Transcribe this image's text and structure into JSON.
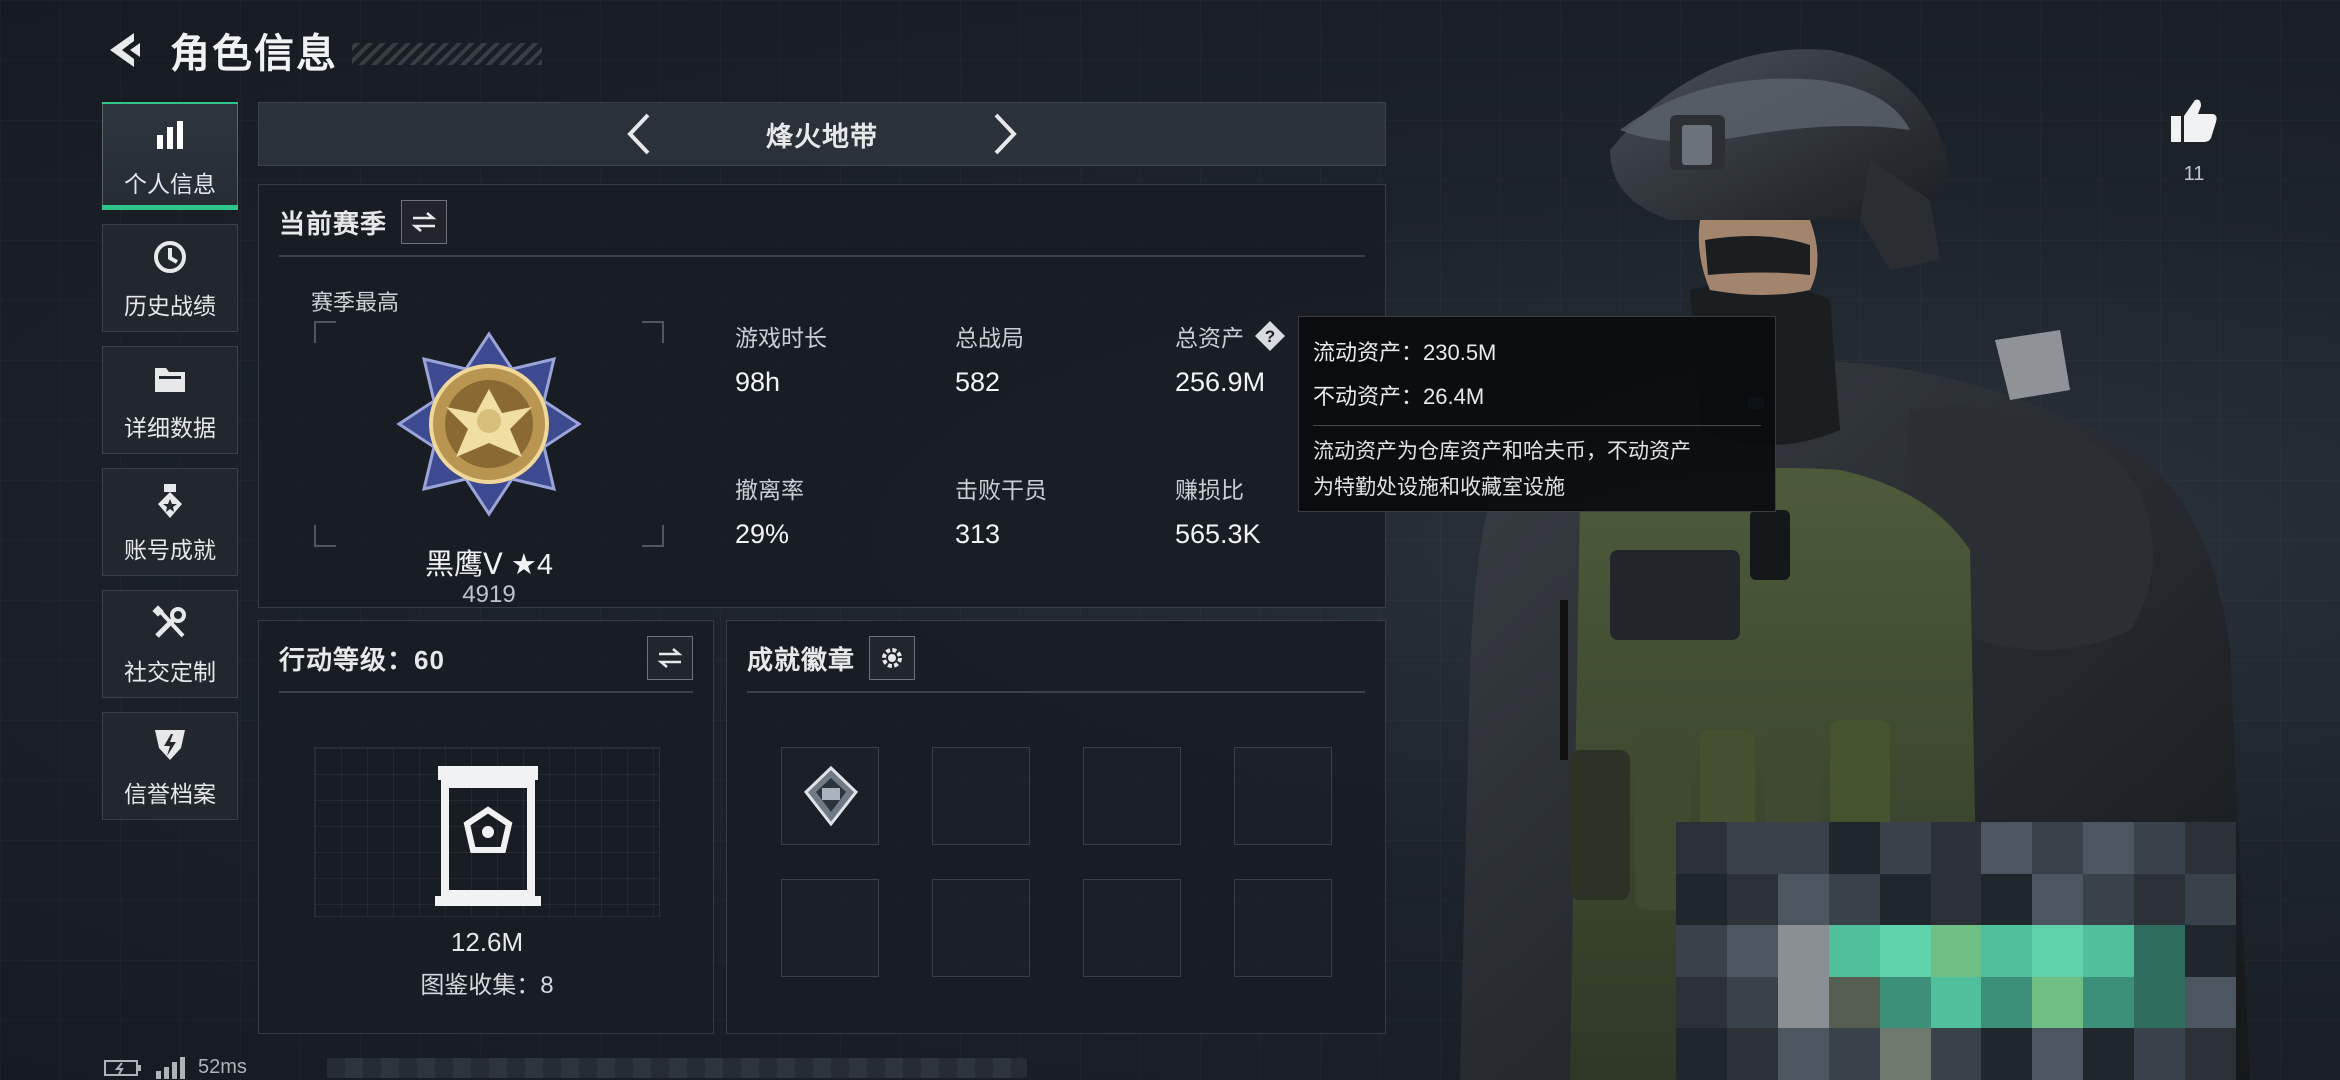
{
  "header": {
    "title": "角色信息"
  },
  "sidenav": {
    "items": [
      {
        "label": "个人信息",
        "icon": "bar-chart-icon",
        "active": true
      },
      {
        "label": "历史战绩",
        "icon": "history-clock-icon",
        "active": false
      },
      {
        "label": "详细数据",
        "icon": "folder-icon",
        "active": false
      },
      {
        "label": "账号成就",
        "icon": "medal-icon",
        "active": false
      },
      {
        "label": "社交定制",
        "icon": "tools-icon",
        "active": false
      },
      {
        "label": "信誉档案",
        "icon": "shield-badge-icon",
        "active": false
      }
    ]
  },
  "mode": {
    "title": "烽火地带"
  },
  "season": {
    "title": "当前赛季",
    "subtitle": "赛季最高",
    "rank_name": "黑鹰Ⅴ ★4",
    "rank_score": "4919",
    "stats": [
      {
        "label": "游戏时长",
        "value": "98h"
      },
      {
        "label": "总战局",
        "value": "582"
      },
      {
        "label": "总资产",
        "value": "256.9M"
      },
      {
        "label": "撤离率",
        "value": "29%"
      },
      {
        "label": "击败干员",
        "value": "313"
      },
      {
        "label": "赚损比",
        "value": "565.3K"
      }
    ]
  },
  "tooltip": {
    "liquid": "流动资产：230.5M",
    "fixed": "不动资产：26.4M",
    "desc_line1": "流动资产为仓库资产和哈夫币，不动资产",
    "desc_line2": "为特勤处设施和收藏室设施"
  },
  "level": {
    "title": "行动等级：60",
    "collect_value": "12.6M",
    "collect_count": "图鉴收集：8"
  },
  "achievements": {
    "title": "成就徽章"
  },
  "like": {
    "count": "11"
  },
  "footer": {
    "ping": "52ms"
  },
  "colors": {
    "accent": "#2fc48a",
    "panel": "#181d23"
  }
}
